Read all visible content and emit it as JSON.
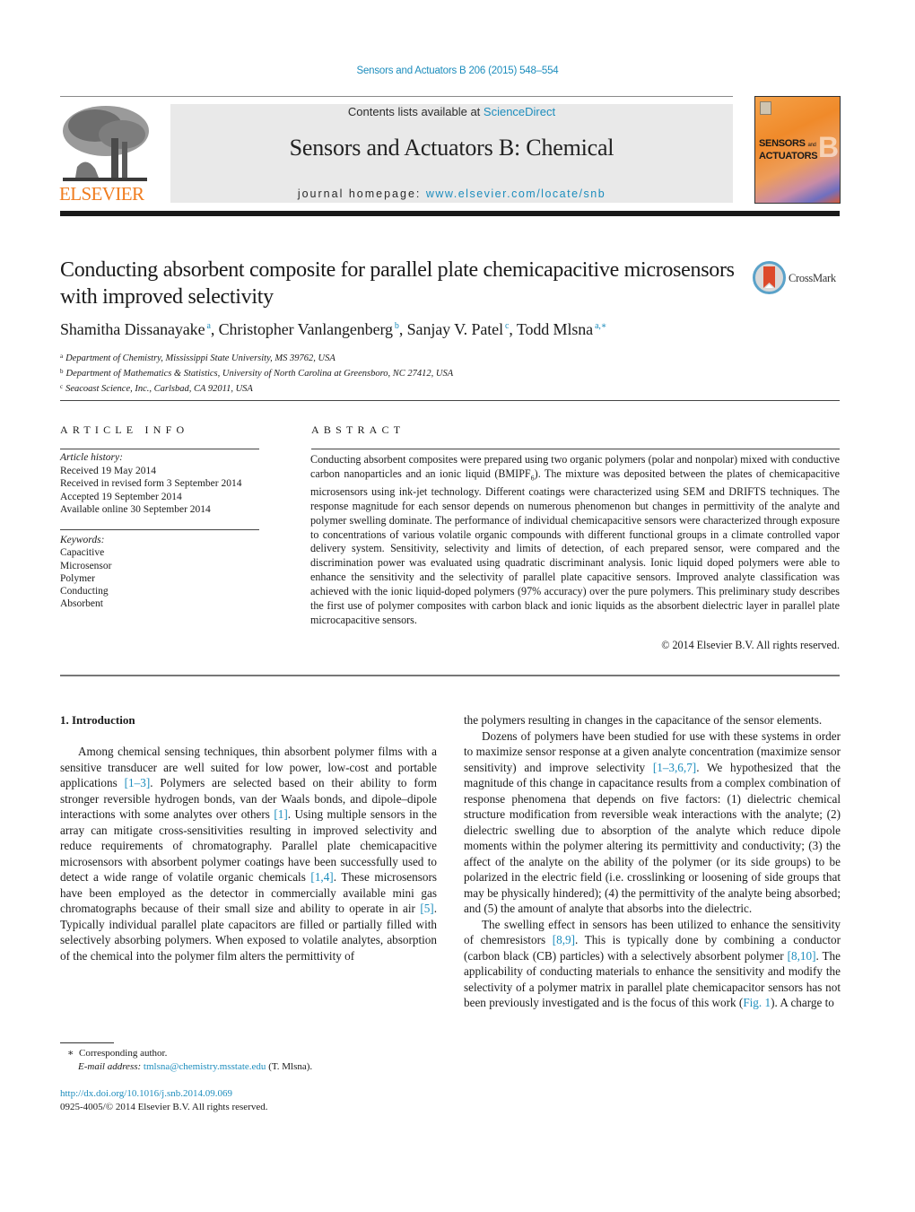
{
  "header": {
    "journal_ref": "Sensors and Actuators B 206 (2015) 548–554",
    "publisher_logo_text": "ELSEVIER",
    "contents_prefix": "Contents lists available at ",
    "contents_link": "ScienceDirect",
    "journal_title": "Sensors and Actuators B: Chemical",
    "homepage_prefix": "journal homepage: ",
    "homepage_link": "www.elsevier.com/locate/snb",
    "cover": {
      "line1": "SENSORS",
      "and": "and",
      "line2": "ACTUATORS",
      "letter": "B"
    },
    "colors": {
      "link": "#1d8dbd",
      "elsevier_orange": "#f07c1e",
      "masthead_bg": "#e9e9e9"
    }
  },
  "article": {
    "title": "Conducting absorbent composite for parallel plate chemicapacitive microsensors with improved selectivity",
    "crossmark_label": "CrossMark",
    "authors": [
      {
        "name": "Shamitha Dissanayake",
        "sup": "a",
        "sep": ", "
      },
      {
        "name": "Christopher Vanlangenberg",
        "sup": "b",
        "sep": ", "
      },
      {
        "name": "Sanjay V. Patel",
        "sup": "c",
        "sep": ", "
      },
      {
        "name": "Todd Mlsna",
        "sup": "a,∗",
        "sep": ""
      }
    ],
    "affiliations": [
      {
        "key": "a",
        "text": "Department of Chemistry, Mississippi State University, MS 39762, USA"
      },
      {
        "key": "b",
        "text": "Department of Mathematics & Statistics, University of North Carolina at Greensboro, NC 27412, USA"
      },
      {
        "key": "c",
        "text": "Seacoast Science, Inc., Carlsbad, CA 92011, USA"
      }
    ]
  },
  "article_info": {
    "heading": "ARTICLE INFO",
    "history_label": "Article history:",
    "history": [
      "Received 19 May 2014",
      "Received in revised form 3 September 2014",
      "Accepted 19 September 2014",
      "Available online 30 September 2014"
    ],
    "keywords_label": "Keywords:",
    "keywords": [
      "Capacitive",
      "Microsensor",
      "Polymer",
      "Conducting",
      "Absorbent"
    ]
  },
  "abstract": {
    "heading": "ABSTRACT",
    "text_before_sub": "Conducting absorbent composites were prepared using two organic polymers (polar and nonpolar) mixed with conductive carbon nanoparticles and an ionic liquid (BMIPF",
    "subscript": "6",
    "text_after_sub": "). The mixture was deposited between the plates of chemicapacitive microsensors using ink-jet technology. Different coatings were characterized using SEM and DRIFTS techniques. The response magnitude for each sensor depends on numerous phenomenon but changes in permittivity of the analyte and polymer swelling dominate. The performance of individual chemicapacitive sensors were characterized through exposure to concentrations of various volatile organic compounds with different functional groups in a climate controlled vapor delivery system. Sensitivity, selectivity and limits of detection, of each prepared sensor, were compared and the discrimination power was evaluated using quadratic discriminant analysis. Ionic liquid doped polymers were able to enhance the sensitivity and the selectivity of parallel plate capacitive sensors. Improved analyte classification was achieved with the ionic liquid-doped polymers (97% accuracy) over the pure polymers. This preliminary study describes the first use of polymer composites with carbon black and ionic liquids as the absorbent dielectric layer in parallel plate microcapacitive sensors.",
    "copyright": "© 2014 Elsevier B.V. All rights reserved."
  },
  "body": {
    "section_heading": "1.  Introduction",
    "left_paragraph": [
      {
        "t": "Among chemical sensing techniques, thin absorbent polymer films with a sensitive transducer are well suited for low power, low-cost and portable applications "
      },
      {
        "ref": "[1–3]"
      },
      {
        "t": ". Polymers are selected based on their ability to form stronger reversible hydrogen bonds, van der Waals bonds, and dipole–dipole interactions with some analytes over others "
      },
      {
        "ref": "[1]"
      },
      {
        "t": ". Using multiple sensors in the array can mitigate cross-sensitivities resulting in improved selectivity and reduce requirements of chromatography. Parallel plate chemicapacitive microsensors with absorbent polymer coatings have been successfully used to detect a wide range of volatile organic chemicals "
      },
      {
        "ref": "[1,4]"
      },
      {
        "t": ". These microsensors have been employed as the detector in commercially available mini gas chromatographs because of their small size and ability to operate in air "
      },
      {
        "ref": "[5]"
      },
      {
        "t": ". Typically individual parallel plate capacitors are filled or partially filled with selectively absorbing polymers. When exposed to volatile analytes, absorption of the chemical into the polymer film alters the permittivity of"
      }
    ],
    "right_paragraphs": [
      {
        "indent": false,
        "parts": [
          {
            "t": "the polymers resulting in changes in the capacitance of the sensor elements."
          }
        ]
      },
      {
        "indent": true,
        "parts": [
          {
            "t": "Dozens of polymers have been studied for use with these systems in order to maximize sensor response at a given analyte concentration (maximize sensor sensitivity) and improve selectivity "
          },
          {
            "ref": "[1–3,6,7]"
          },
          {
            "t": ". We hypothesized that the magnitude of this change in capacitance results from a complex combination of response phenomena that depends on five factors: (1) dielectric chemical structure modification from reversible weak interactions with the analyte; (2) dielectric swelling due to absorption of the analyte which reduce dipole moments within the polymer altering its permittivity and conductivity; (3) the affect of the analyte on the ability of the polymer (or its side groups) to be polarized in the electric field (i.e. crosslinking or loosening of side groups that may be physically hindered); (4) the permittivity of the analyte being absorbed; and (5) the amount of analyte that absorbs into the dielectric."
          }
        ]
      },
      {
        "indent": true,
        "parts": [
          {
            "t": "The swelling effect in sensors has been utilized to enhance the sensitivity of chemresistors "
          },
          {
            "ref": "[8,9]"
          },
          {
            "t": ". This is typically done by combining a conductor (carbon black (CB) particles) with a selectively absorbent polymer "
          },
          {
            "ref": "[8,10]"
          },
          {
            "t": ". The applicability of conducting materials to enhance the sensitivity and modify the selectivity of a polymer matrix in parallel plate chemicapacitor sensors has not been previously investigated and is the focus of this work ("
          },
          {
            "ref": "Fig. 1"
          },
          {
            "t": "). A charge to"
          }
        ]
      }
    ]
  },
  "footnotes": {
    "star": "∗",
    "corresponding": "Corresponding author.",
    "email_label": "E-mail address: ",
    "email": "tmlsna@chemistry.msstate.edu",
    "email_suffix": " (T. Mlsna).",
    "doi": "http://dx.doi.org/10.1016/j.snb.2014.09.069",
    "issn_line": "0925-4005/© 2014 Elsevier B.V. All rights reserved."
  }
}
